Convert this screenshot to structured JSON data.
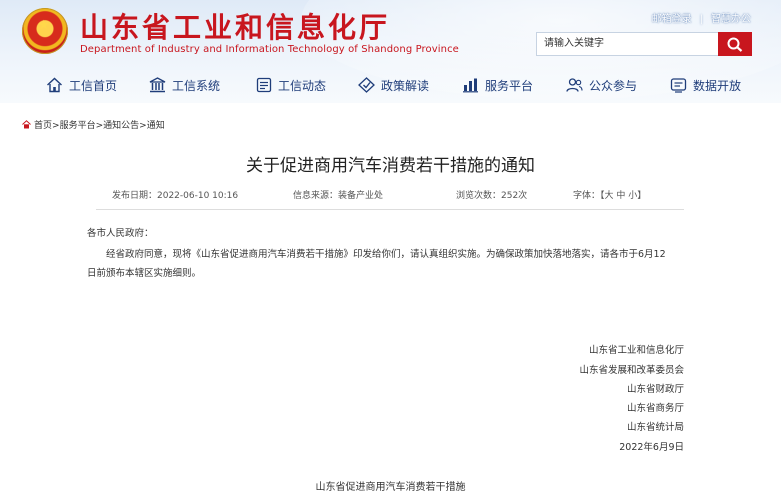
{
  "header": {
    "title": "山东省工业和信息化厅",
    "subtitle": "Department of Industry and Information Technology of Shandong Province",
    "links": [
      "邮箱登录",
      "智慧办公"
    ],
    "search_placeholder": "请输入关键字"
  },
  "nav": [
    {
      "label": "工信首页",
      "icon": "home-icon"
    },
    {
      "label": "工信系统",
      "icon": "building-icon"
    },
    {
      "label": "工信动态",
      "icon": "news-icon"
    },
    {
      "label": "政策解读",
      "icon": "policy-icon"
    },
    {
      "label": "服务平台",
      "icon": "chart-icon"
    },
    {
      "label": "公众参与",
      "icon": "user-icon"
    },
    {
      "label": "数据开放",
      "icon": "data-icon"
    }
  ],
  "breadcrumb": [
    "首页",
    "服务平台",
    "通知公告",
    "通知"
  ],
  "article": {
    "title": "关于促进商用汽车消费若干措施的通知",
    "date": "发布日期：2022-06-10 10:16",
    "source": "信息来源：装备产业处",
    "views": "浏览次数：252次",
    "font_size": "字体：【大 中 小】",
    "salutation": "各市人民政府：",
    "paragraph_line1": "经省政府同意，现将《山东省促进商用汽车消费若干措施》印发给你们，请认真组织实施。为确保政策加快落地落实，请各市于6月12",
    "paragraph_line2": "日前颁布本辖区实施细则。",
    "signatories": [
      "山东省工业和信息化厅",
      "山东省发展和改革委员会",
      "山东省财政厅",
      "山东省商务厅",
      "山东省统计局"
    ],
    "sign_date": "2022年6月9日",
    "attachment_title": "山东省促进商用汽车消费若干措施"
  },
  "colors": {
    "brand_red": "#c8161e",
    "nav_blue": "#1f3d7a"
  }
}
